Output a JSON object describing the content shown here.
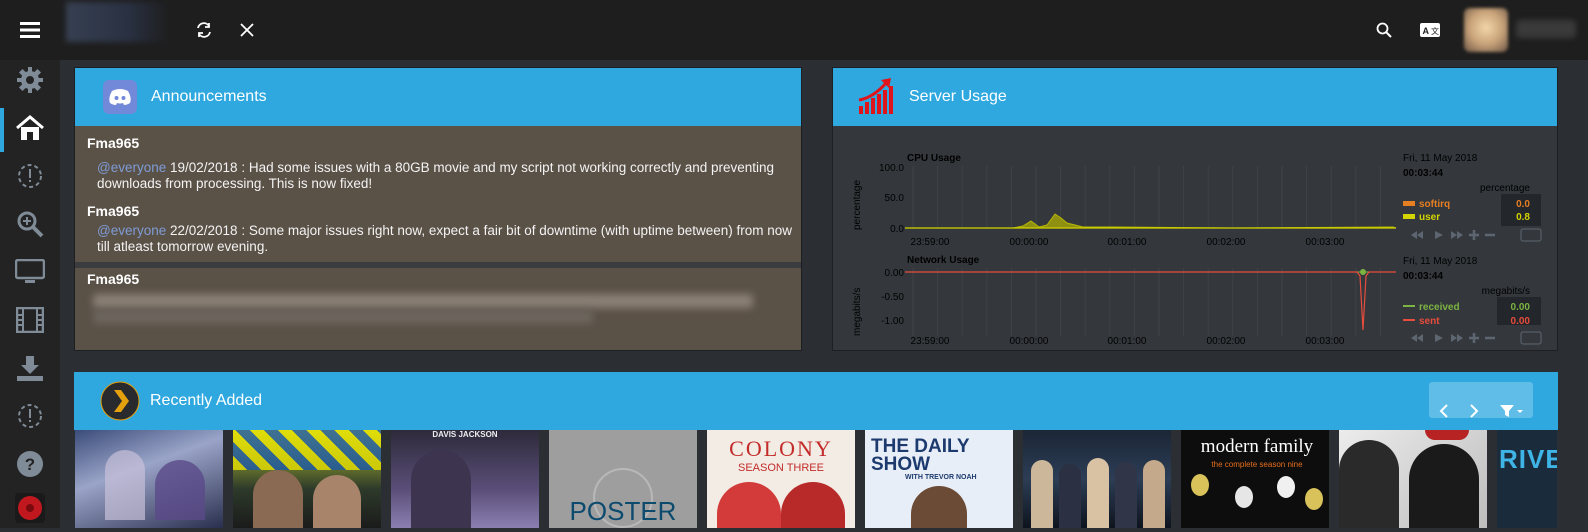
{
  "topbar": {
    "menu_icon": "hamburger-icon",
    "refresh_icon": "refresh-icon",
    "close_icon": "close-icon",
    "search_icon": "search-icon",
    "translate_icon": "translate-icon"
  },
  "sidebar": {
    "items": [
      {
        "icon": "gear-icon"
      },
      {
        "icon": "home-icon"
      },
      {
        "icon": "alert-dashed-icon"
      },
      {
        "icon": "zoom-in-icon"
      },
      {
        "icon": "monitor-icon"
      },
      {
        "icon": "film-icon"
      },
      {
        "icon": "download-icon"
      },
      {
        "icon": "alert-dashed-icon"
      },
      {
        "icon": "help-icon"
      },
      {
        "icon": "app-red-icon"
      }
    ]
  },
  "announcements": {
    "title": "Announcements",
    "icon": "discord-icon",
    "posts": [
      {
        "author": "Fma965",
        "mention": "@everyone",
        "text": " 19/02/2018 : Had some issues with a 80GB movie and my script not working correctly and preventing downloads from processing. This is now fixed!"
      },
      {
        "author": "Fma965",
        "mention": "@everyone",
        "text": " 22/02/2018 : Some major issues right now, expect a fair bit of downtime (with uptime between) from now till atleast tomorrow evening."
      },
      {
        "author": "Fma965"
      }
    ]
  },
  "server_usage": {
    "title": "Server Usage",
    "icon": "chart-up-icon",
    "cpu": {
      "title": "CPU Usage",
      "ylabel": "percentage",
      "yticks": [
        "100.0",
        "50.0",
        "0.0"
      ],
      "xticks": [
        "23:59:00",
        "00:00:00",
        "00:01:00",
        "00:02:00",
        "00:03:00"
      ],
      "date": "Fri, 11 May 2018",
      "time": "00:03:44",
      "unit": "percentage",
      "legend": [
        {
          "name": "softirq",
          "value": "0.0",
          "color": "#e67e22"
        },
        {
          "name": "user",
          "value": "0.8",
          "color": "#d4d400"
        }
      ]
    },
    "network": {
      "title": "Network Usage",
      "ylabel": "megabits/s",
      "yticks": [
        "0.00",
        "-0.50",
        "-1.00"
      ],
      "xticks": [
        "23:59:00",
        "00:00:00",
        "00:01:00",
        "00:02:00",
        "00:03:00"
      ],
      "date": "Fri, 11 May 2018",
      "time": "00:03:44",
      "unit": "megabits/s",
      "legend": [
        {
          "name": "received",
          "value": "0.00",
          "color": "#7cb342"
        },
        {
          "name": "sent",
          "value": "0.00",
          "color": "#e74c3c"
        }
      ]
    }
  },
  "recently_added": {
    "title": "Recently Added",
    "icon": "plex-icon",
    "prev_icon": "chevron-left-icon",
    "next_icon": "chevron-right-icon",
    "filter_icon": "filter-icon",
    "posters": [
      {
        "label": ""
      },
      {
        "label": ""
      },
      {
        "label": "DAVIS  JACKSON"
      },
      {
        "label": "POSTER"
      },
      {
        "label": "COLONY",
        "sub": "SEASON THREE"
      },
      {
        "label": "THE DAILY SHOW",
        "sub": "WITH TREVOR NOAH"
      },
      {
        "label": ""
      },
      {
        "label": "modern family",
        "sub": "the complete season nine"
      },
      {
        "label": ""
      },
      {
        "label": "RIVE"
      }
    ]
  },
  "colors": {
    "accent": "#2ea8df",
    "sidebar": "#232323",
    "topbar": "#1e1e1e",
    "panel": "#34383c"
  }
}
